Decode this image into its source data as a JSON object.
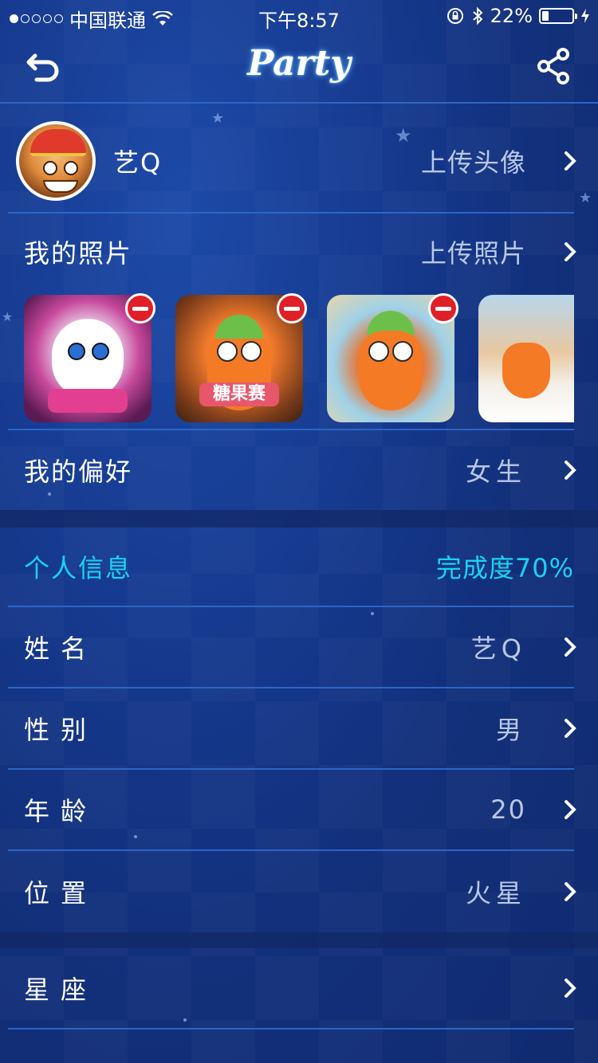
{
  "status_bar": {
    "carrier": "中国联通",
    "time": "下午8:57",
    "battery": "22%",
    "battery_level": 0.22,
    "icons": [
      "signal-dots-icon",
      "wifi-icon",
      "rotation-lock-icon",
      "bluetooth-icon",
      "battery-icon",
      "charging-bolt-icon"
    ]
  },
  "nav": {
    "title": "Party",
    "back_icon": "back-arrow-icon",
    "share_icon": "share-icon"
  },
  "profile": {
    "nickname": "艺Q",
    "upload_avatar": "上传头像"
  },
  "photos": {
    "label": "我的照片",
    "upload": "上传照片",
    "items": [
      {
        "deletable": true
      },
      {
        "deletable": true,
        "caption": "糖果赛"
      },
      {
        "deletable": true
      },
      {
        "deletable": false
      }
    ]
  },
  "preference": {
    "label": "我的偏好",
    "value": "女生"
  },
  "info": {
    "title": "个人信息",
    "completion": "完成度70%",
    "completion_value": 0.7,
    "rows": [
      {
        "label": "姓名",
        "value": "艺Q"
      },
      {
        "label": "性别",
        "value": "男"
      },
      {
        "label": "年龄",
        "value": "20"
      },
      {
        "label": "位置",
        "value": "火星"
      }
    ]
  },
  "zodiac": {
    "label": "星座",
    "value": ""
  },
  "colors": {
    "accent": "#19d3f2",
    "divider": "#2a66c8",
    "delete": "#e01f26",
    "background": "#163a8f"
  }
}
